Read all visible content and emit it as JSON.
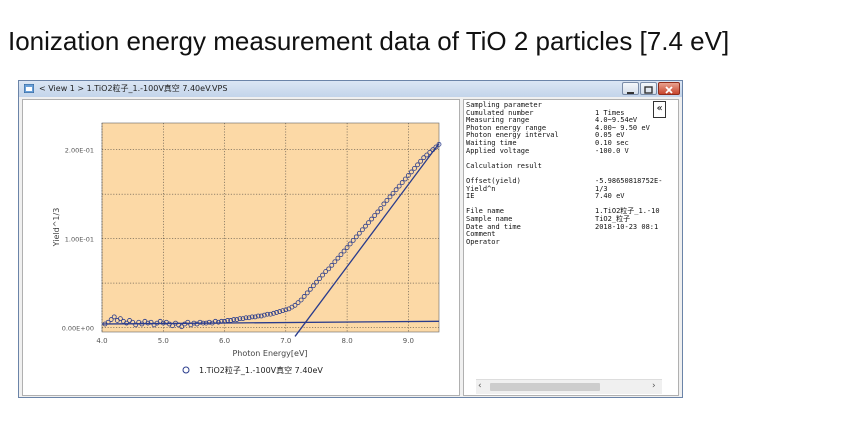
{
  "page_title": "Ionization energy measurement data of TiO 2 particles [7.4 eV]",
  "window": {
    "title": "< View 1 >   1.TiO2粒子_1.-100V真空 7.40eV.VPS"
  },
  "colors": {
    "plot_bg": "#fcd9a6",
    "series": "#2a3c8c",
    "grid": "#333333"
  },
  "chart_data": {
    "type": "scatter",
    "title": "",
    "xlabel": "Photon Energy[eV]",
    "ylabel": "Yield^1/3",
    "xlim": [
      4.0,
      9.5
    ],
    "ylim": [
      -0.005,
      0.23
    ],
    "x_ticks": [
      4.0,
      5.0,
      6.0,
      7.0,
      8.0,
      9.0
    ],
    "x_tick_labels": [
      "4.0",
      "5.0",
      "6.0",
      "7.0",
      "8.0",
      "9.0"
    ],
    "y_ticks": [
      0.0,
      0.1,
      0.2
    ],
    "y_tick_labels": [
      "0.00E+00",
      "1.00E-01",
      "2.00E-01"
    ],
    "grid": true,
    "legend_position": "bottom",
    "series": [
      {
        "name": "1.TiO2粒子_1.-100V真空 7.40eV",
        "marker": "open-circle",
        "x": [
          4.05,
          4.1,
          4.15,
          4.2,
          4.25,
          4.3,
          4.35,
          4.4,
          4.45,
          4.5,
          4.55,
          4.6,
          4.65,
          4.7,
          4.75,
          4.8,
          4.85,
          4.9,
          4.95,
          5.0,
          5.05,
          5.1,
          5.15,
          5.2,
          5.25,
          5.3,
          5.35,
          5.4,
          5.45,
          5.5,
          5.55,
          5.6,
          5.65,
          5.7,
          5.75,
          5.8,
          5.85,
          5.9,
          5.95,
          6.0,
          6.05,
          6.1,
          6.15,
          6.2,
          6.25,
          6.3,
          6.35,
          6.4,
          6.45,
          6.5,
          6.55,
          6.6,
          6.65,
          6.7,
          6.75,
          6.8,
          6.85,
          6.9,
          6.95,
          7.0,
          7.05,
          7.1,
          7.15,
          7.2,
          7.25,
          7.3,
          7.35,
          7.4,
          7.45,
          7.5,
          7.55,
          7.6,
          7.65,
          7.7,
          7.75,
          7.8,
          7.85,
          7.9,
          7.95,
          8.0,
          8.05,
          8.1,
          8.15,
          8.2,
          8.25,
          8.3,
          8.35,
          8.4,
          8.45,
          8.5,
          8.55,
          8.6,
          8.65,
          8.7,
          8.75,
          8.8,
          8.85,
          8.9,
          8.95,
          9.0,
          9.05,
          9.1,
          9.15,
          9.2,
          9.25,
          9.3,
          9.35,
          9.4,
          9.45,
          9.5
        ],
        "y": [
          0.004,
          0.006,
          0.009,
          0.012,
          0.008,
          0.01,
          0.007,
          0.005,
          0.008,
          0.006,
          0.003,
          0.006,
          0.004,
          0.007,
          0.005,
          0.006,
          0.003,
          0.005,
          0.007,
          0.005,
          0.006,
          0.004,
          0.002,
          0.005,
          0.003,
          0.001,
          0.004,
          0.006,
          0.003,
          0.005,
          0.004,
          0.006,
          0.005,
          0.005,
          0.006,
          0.005,
          0.007,
          0.006,
          0.007,
          0.007,
          0.008,
          0.008,
          0.009,
          0.009,
          0.01,
          0.01,
          0.011,
          0.011,
          0.012,
          0.012,
          0.013,
          0.013,
          0.014,
          0.015,
          0.015,
          0.016,
          0.017,
          0.018,
          0.019,
          0.02,
          0.021,
          0.023,
          0.025,
          0.028,
          0.031,
          0.035,
          0.039,
          0.043,
          0.047,
          0.051,
          0.055,
          0.059,
          0.063,
          0.066,
          0.07,
          0.074,
          0.078,
          0.082,
          0.086,
          0.09,
          0.094,
          0.098,
          0.102,
          0.106,
          0.11,
          0.114,
          0.118,
          0.122,
          0.126,
          0.13,
          0.134,
          0.139,
          0.143,
          0.147,
          0.151,
          0.155,
          0.159,
          0.163,
          0.167,
          0.171,
          0.175,
          0.179,
          0.183,
          0.187,
          0.191,
          0.194,
          0.197,
          0.2,
          0.203,
          0.206
        ]
      }
    ],
    "fit_lines": [
      {
        "kind": "baseline",
        "x": [
          4.0,
          9.5
        ],
        "y": [
          0.004,
          0.007
        ]
      },
      {
        "kind": "slope",
        "x": [
          7.15,
          9.5
        ],
        "y": [
          -0.01,
          0.207
        ]
      }
    ]
  },
  "info": {
    "labels": [
      "Sampling parameter",
      "Cumulated number",
      "Measuring range",
      "Photon energy range",
      "Photon energy interval",
      "Waiting time",
      "Applied voltage",
      "",
      "Calculation result",
      "",
      "Offset(yield)",
      "Yield^n",
      "IE",
      "",
      "File name",
      "Sample name",
      "Date and time",
      "Comment",
      "Operator"
    ],
    "values": [
      "",
      "1 Times",
      "4.0~9.54eV",
      "4.00~ 9.50 eV",
      "0.05 eV",
      "0.10 sec",
      "-100.0 V",
      "",
      "",
      "",
      "-5.98650818752E-",
      "1/3",
      "7.40 eV",
      "",
      "1.TiO2粒子_1.-10",
      "TiO2_粒子",
      "2018-10-23  08:1",
      "",
      ""
    ],
    "collapse_symbol": "«"
  },
  "scrollbar": {
    "left_arrow": "‹",
    "right_arrow": "›"
  }
}
